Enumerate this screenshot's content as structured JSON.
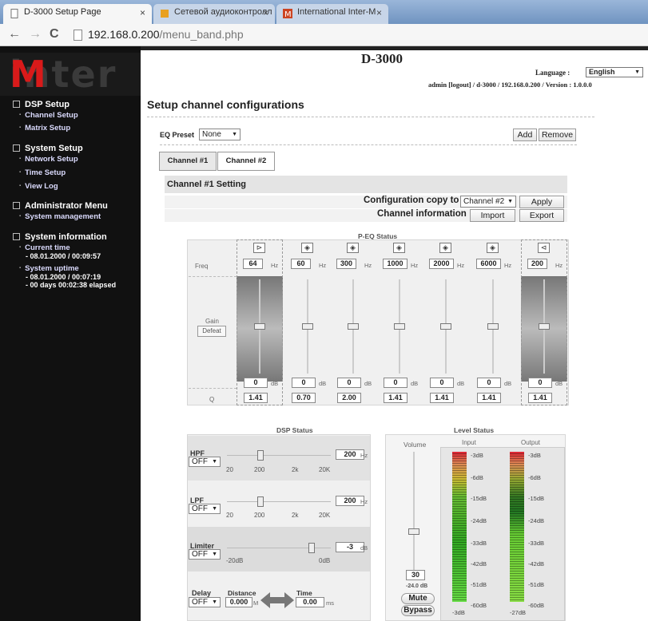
{
  "browser": {
    "tabs": [
      {
        "title": "D-3000 Setup Page",
        "active": true
      },
      {
        "title": "Сетевой аудиоконтролл",
        "active": false
      },
      {
        "title": "International Inter-M",
        "active": false
      }
    ],
    "url_host": "192.168.0.200",
    "url_path": "/menu_band.php"
  },
  "sidebar": {
    "logo_text": "inter",
    "logo_mark": "M",
    "sections": [
      {
        "title": "DSP Setup",
        "items": [
          "Channel Setup",
          "Matrix Setup"
        ]
      },
      {
        "title": "System Setup",
        "items": [
          "Network Setup",
          "Time Setup",
          "View Log"
        ]
      },
      {
        "title": "Administrator Menu",
        "items": [
          "System management"
        ]
      },
      {
        "title": "System information",
        "items": [
          "Current time",
          "System uptime"
        ]
      }
    ],
    "current_time_value": "- 08.01.2000 / 00:09:57",
    "uptime_value_1": "- 08.01.2000 / 00:07:19",
    "uptime_value_2": "- 00 days 00:02:38 elapsed"
  },
  "header": {
    "product": "D-3000",
    "language_label": "Language :",
    "language_value": "English",
    "admin_line": "admin [logout] / d-3000 / 192.168.0.200 / Version : 1.0.0.0"
  },
  "main": {
    "title": "Setup channel configurations",
    "eq_preset_label": "EQ Preset",
    "eq_preset_value": "None",
    "add_label": "Add",
    "remove_label": "Remove",
    "channel_tabs": [
      "Channel #1",
      "Channel #2"
    ],
    "setting_title": "Channel #1 Setting",
    "config_copy_label": "Configuration copy to",
    "config_copy_value": "Channel #2",
    "apply_label": "Apply",
    "channel_info_label": "Channel information",
    "import_label": "Import",
    "export_label": "Export"
  },
  "peq": {
    "title": "P-EQ Status",
    "freq_label": "Freq",
    "gain_label": "Gain",
    "defeat_label": "Defeat",
    "q_label": "Q",
    "hz": "Hz",
    "db": "dB",
    "bands": [
      {
        "icon": "high-pass-filter-icon",
        "freq": "64",
        "gain": "0",
        "q": "1.41",
        "gain_level": 0.5
      },
      {
        "icon": "peaking-filter-icon",
        "freq": "60",
        "gain": "0",
        "q": "0.70",
        "gain_level": 0.5
      },
      {
        "icon": "peaking-filter-icon",
        "freq": "300",
        "gain": "0",
        "q": "2.00",
        "gain_level": 0.5
      },
      {
        "icon": "peaking-filter-icon",
        "freq": "1000",
        "gain": "0",
        "q": "1.41",
        "gain_level": 0.5
      },
      {
        "icon": "peaking-filter-icon",
        "freq": "2000",
        "gain": "0",
        "q": "1.41",
        "gain_level": 0.5
      },
      {
        "icon": "peaking-filter-icon",
        "freq": "6000",
        "gain": "0",
        "q": "1.41",
        "gain_level": 0.5
      },
      {
        "icon": "low-pass-filter-icon",
        "freq": "200",
        "gain": "0",
        "q": "1.41",
        "gain_level": 0.5
      }
    ]
  },
  "dsp": {
    "title": "DSP Status",
    "hpf": {
      "label": "HPF",
      "state": "OFF",
      "value": "200",
      "unit": "Hz",
      "ticks": [
        "20",
        "200",
        "2k",
        "20K"
      ]
    },
    "lpf": {
      "label": "LPF",
      "state": "OFF",
      "value": "200",
      "unit": "Hz",
      "ticks": [
        "20",
        "200",
        "2k",
        "20K"
      ]
    },
    "limiter": {
      "label": "Limiter",
      "state": "OFF",
      "value": "-3",
      "unit": "dB",
      "ticks": [
        "-20dB",
        "0dB"
      ]
    },
    "delay": {
      "label": "Delay",
      "state": "OFF",
      "distance_label": "Distance",
      "distance": "0.000",
      "distance_unit": "M",
      "time_label": "Time",
      "time": "0.00",
      "time_unit": "ms"
    }
  },
  "level": {
    "title": "Level Status",
    "volume_label": "Volume",
    "volume_value": "30",
    "volume_db": "-24.0 dB",
    "mute_label": "Mute",
    "bypass_label": "Bypass",
    "input_label": "Input",
    "output_label": "Output",
    "scale": [
      "-3dB",
      "-6dB",
      "-15dB",
      "-24dB",
      "-33dB",
      "-42dB",
      "-51dB",
      "-60dB"
    ],
    "input_reading": "-3dB",
    "output_reading": "-27dB"
  }
}
